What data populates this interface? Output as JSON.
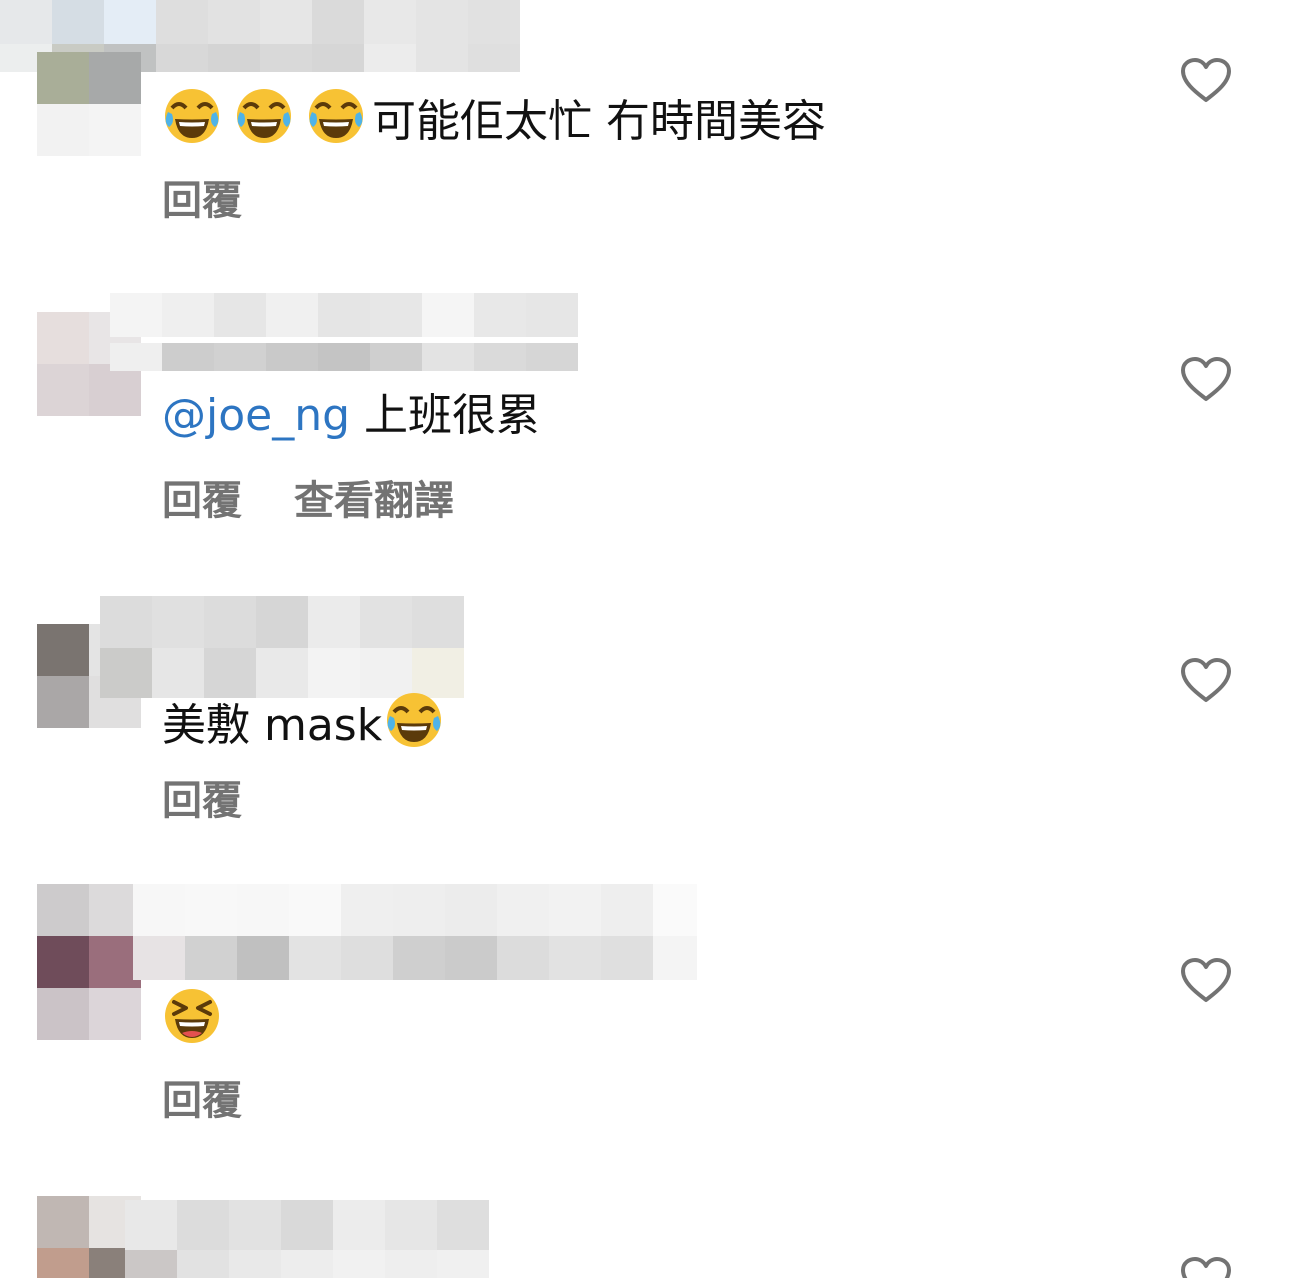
{
  "comments": [
    {
      "text": "可能佢太忙 冇時間美容",
      "emoji_prefix": [
        "face-with-tears-of-joy",
        "face-with-tears-of-joy",
        "face-with-tears-of-joy"
      ],
      "actions": [
        "回覆"
      ]
    },
    {
      "mention": "@joe_ng",
      "text": " 上班很累",
      "actions": [
        "回覆",
        "查看翻譯"
      ]
    },
    {
      "text": "美敷 mask",
      "emoji_suffix": "face-with-tears-of-joy",
      "actions": [
        "回覆"
      ]
    },
    {
      "emoji_only": "grinning-squinting-face",
      "actions": [
        "回覆"
      ]
    }
  ],
  "colors": {
    "mention": "#2d75c2",
    "action_text": "#737373",
    "heart_outline": "#737373"
  }
}
